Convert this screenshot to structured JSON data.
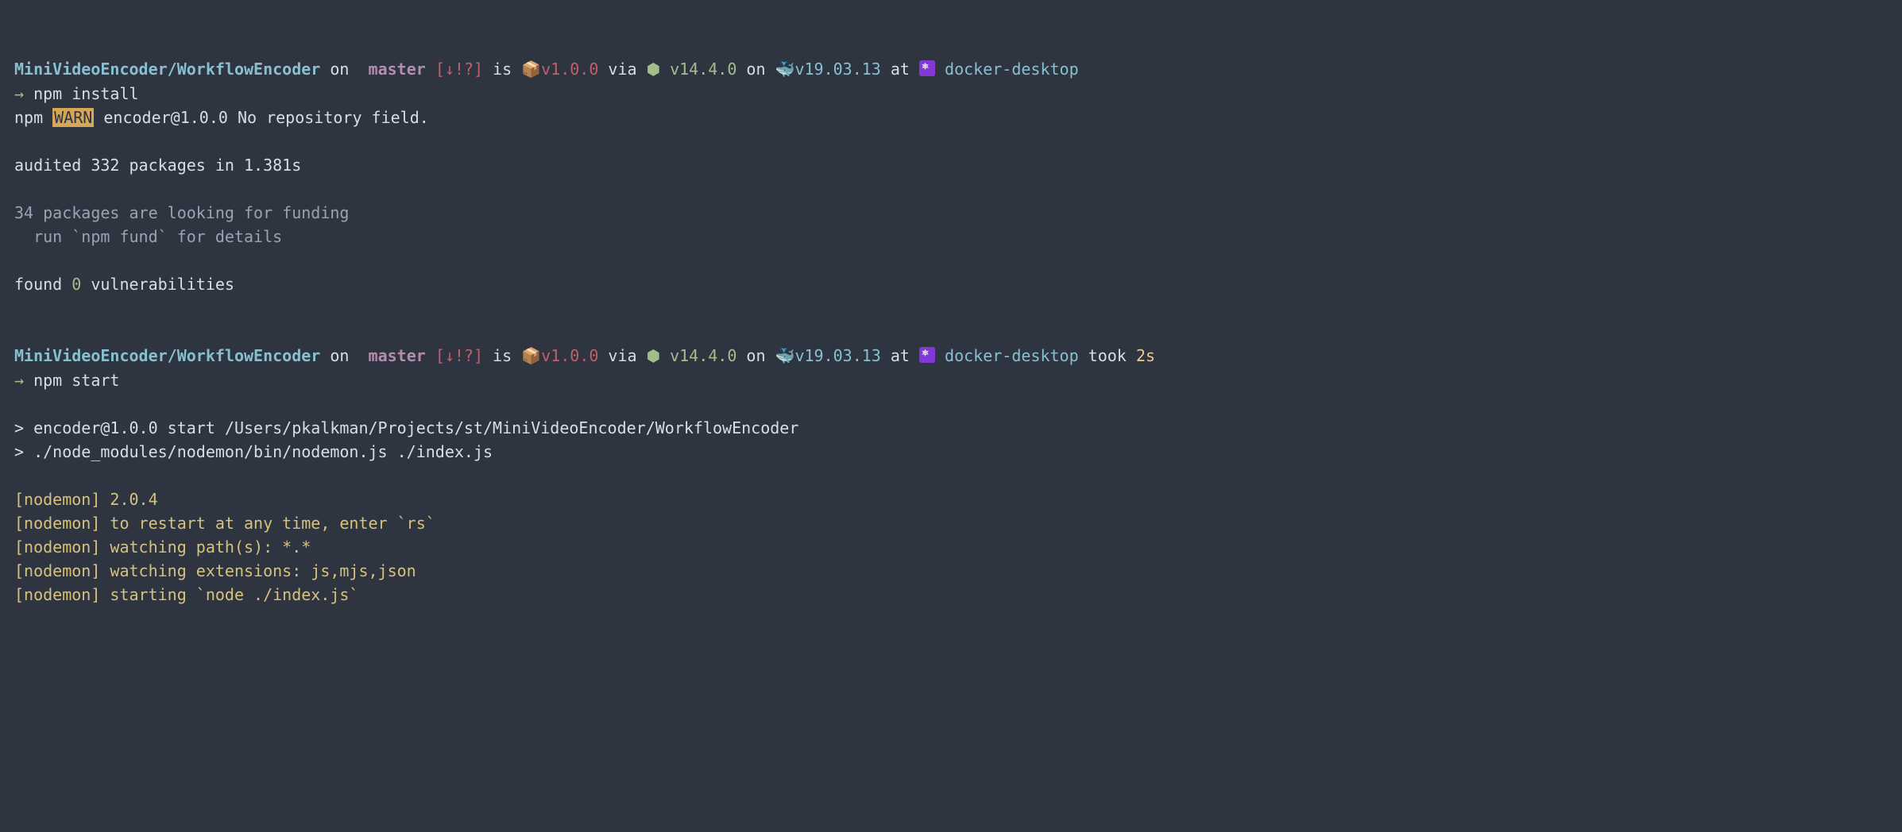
{
  "prompt1": {
    "path": "MiniVideoEncoder/WorkflowEncoder",
    "on": " on ",
    "branch_icon": "",
    "branch_sep": " ",
    "branch": "master",
    "status": " [↓!?]",
    "is": " is ",
    "pkg_icon": "📦",
    "pkg_ver": "v1.0.0",
    "via": " via ",
    "node_icon": "⬢ ",
    "node_ver": "v14.4.0",
    "on2": " on ",
    "docker_icon": "🐳",
    "docker_ver": "v19.03.13",
    "at": " at ",
    "k8s_ctx": " docker-desktop",
    "arrow": "→ ",
    "command": "npm install"
  },
  "output1": {
    "npm": "npm ",
    "warn": "WARN",
    "warn_msg": " encoder@1.0.0 No repository field.",
    "blank1": "",
    "audited": "audited 332 packages in 1.381s",
    "blank2": "",
    "funding1": "34 packages are looking for funding",
    "funding2": "  run `npm fund` for details",
    "blank3": "",
    "found_pre": "found ",
    "found_num": "0",
    "found_post": " vulnerabilities",
    "blank4": "",
    "blank5": ""
  },
  "prompt2": {
    "path": "MiniVideoEncoder/WorkflowEncoder",
    "on": " on ",
    "branch_icon": "",
    "branch_sep": " ",
    "branch": "master",
    "status": " [↓!?]",
    "is": " is ",
    "pkg_icon": "📦",
    "pkg_ver": "v1.0.0",
    "via": " via ",
    "node_icon": "⬢ ",
    "node_ver": "v14.4.0",
    "on2": " on ",
    "docker_icon": "🐳",
    "docker_ver": "v19.03.13",
    "at": " at ",
    "k8s_ctx": " docker-desktop",
    "took": " took ",
    "took_val": "2s",
    "arrow": "→ ",
    "command": "npm start"
  },
  "output2": {
    "blank1": "",
    "l1": "> encoder@1.0.0 start /Users/pkalkman/Projects/st/MiniVideoEncoder/WorkflowEncoder",
    "l2": "> ./node_modules/nodemon/bin/nodemon.js ./index.js",
    "blank2": "",
    "n1": "[nodemon] 2.0.4",
    "n2": "[nodemon] to restart at any time, enter `rs`",
    "n3": "[nodemon] watching path(s): *.*",
    "n4": "[nodemon] watching extensions: js,mjs,json",
    "n5": "[nodemon] starting `node ./index.js`"
  }
}
